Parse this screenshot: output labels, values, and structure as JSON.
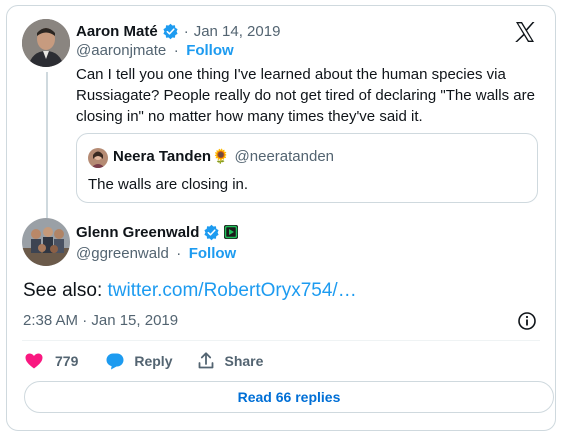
{
  "parent": {
    "author_name": "Aaron Maté",
    "date": "Jan 14, 2019",
    "handle": "@aaronjmate",
    "follow_label": "Follow",
    "text_line1": "Can I tell you one thing I've learned about the human species via",
    "text_line2": "Russiagate? People really do not get tired of declaring \"The walls are",
    "text_line3": "closing in\" no matter how many times they've said it.",
    "quote": {
      "author_name": "Neera Tanden",
      "emoji": "🌻",
      "handle": "@neeratanden",
      "text": "The walls are closing in."
    }
  },
  "reply": {
    "author_name": "Glenn Greenwald",
    "handle": "@ggreenwald",
    "follow_label": "Follow",
    "text_prefix": "See also: ",
    "link_text": "twitter.com/RobertOryx754/…",
    "timestamp": "2:38 AM · Jan 15, 2019"
  },
  "actions": {
    "like_count": "779",
    "reply_label": "Reply",
    "share_label": "Share"
  },
  "read_replies_label": "Read 66 replies",
  "separator": "·",
  "colors": {
    "accent": "#1d9bf0",
    "like": "#f91880",
    "muted": "#536471",
    "border": "#cfd9de"
  }
}
